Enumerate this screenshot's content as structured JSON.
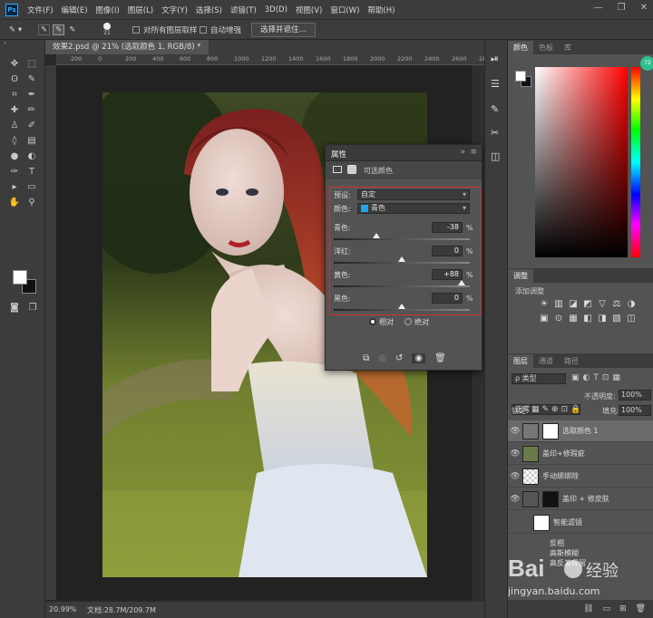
{
  "menubar": {
    "logo": "Ps",
    "items": [
      "文件(F)",
      "编辑(E)",
      "图像(I)",
      "图层(L)",
      "文字(Y)",
      "选择(S)",
      "滤镜(T)",
      "3D(D)",
      "视图(V)",
      "窗口(W)",
      "帮助(H)"
    ],
    "min": "—",
    "max": "❐",
    "close": "✕"
  },
  "options": {
    "brush_size": "21",
    "sample_all": "对所有图层取样",
    "auto_enhance": "自动增强",
    "select_subject": "选择并遮住…"
  },
  "document": {
    "tab": "效果2.psd @ 21% (选取颜色 1, RGB/8) *",
    "ruler_ticks": [
      "200",
      "0",
      "200",
      "400",
      "600",
      "800",
      "1000",
      "1200",
      "1400",
      "1600",
      "1800",
      "2000",
      "2200",
      "2400",
      "2600",
      "2800"
    ],
    "zoom": "20.99%",
    "doc_size": "文档:28.7M/209.7M"
  },
  "properties": {
    "title": "属性",
    "type_label": "可选颜色",
    "preset_label": "预设:",
    "preset_value": "自定",
    "colors_label": "颜色:",
    "colors_value": "青色",
    "colors_swatch": "#29a3e0",
    "sliders": [
      {
        "label": "青色:",
        "value": "-38",
        "pct": "%",
        "pos": 0.31
      },
      {
        "label": "洋红:",
        "value": "0",
        "pct": "%",
        "pos": 0.5
      },
      {
        "label": "黄色:",
        "value": "+88",
        "pct": "%",
        "pos": 0.94
      },
      {
        "label": "黑色:",
        "value": "0",
        "pct": "%",
        "pos": 0.5
      }
    ],
    "relative": "相对",
    "absolute": "绝对"
  },
  "colorpanel": {
    "tabs": [
      "颜色",
      "色板",
      "库"
    ]
  },
  "adjustments": {
    "tab": "调整",
    "add": "添加调整"
  },
  "layers": {
    "tabs": [
      "图层",
      "通道",
      "路径"
    ],
    "kind": "ρ 类型",
    "blend": "正常",
    "opacity_label": "不透明度:",
    "opacity": "100%",
    "lock_label": "锁定:",
    "fill_label": "填充:",
    "fill": "100%",
    "items": [
      {
        "name": "选取颜色 1",
        "type": "adjustment"
      },
      {
        "name": "盖印+修瑕疵",
        "type": "photo"
      },
      {
        "name": "手动绑绑除",
        "type": "empty"
      },
      {
        "name": "盖印 + 修皮肤",
        "type": "smart"
      }
    ],
    "smart_filters": "智能滤镜",
    "filters": [
      "反相",
      "高斯模糊",
      "高反差保留"
    ]
  },
  "watermark": {
    "brand": "Bai",
    "brand2": "经验",
    "url": "jingyan.baidu.com"
  }
}
